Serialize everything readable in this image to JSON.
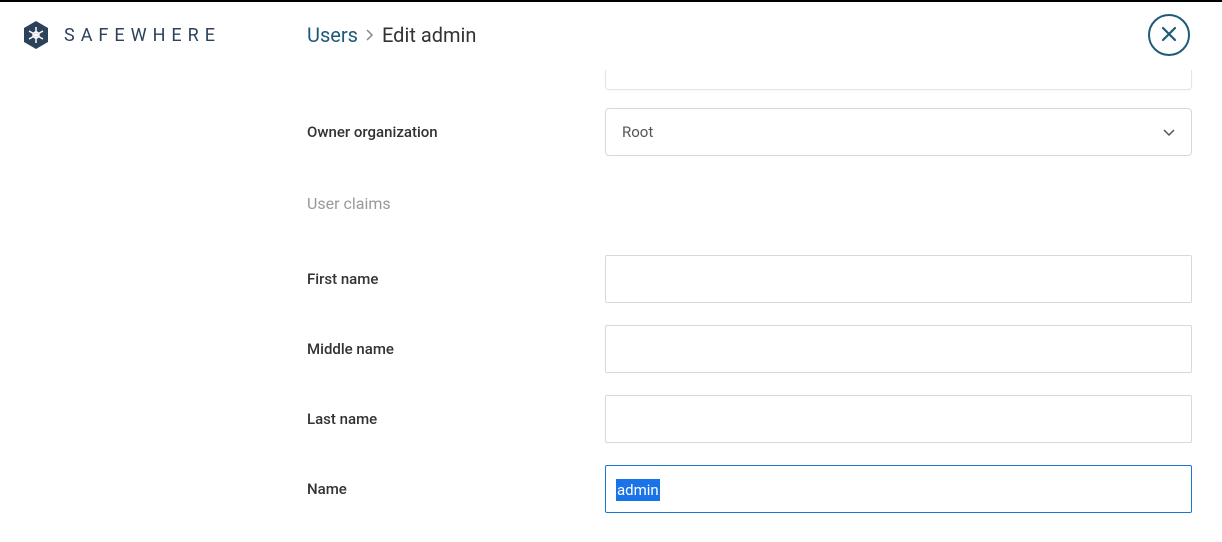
{
  "brand": "SAFEWHERE",
  "breadcrumbs": {
    "root": "Users",
    "current": "Edit admin"
  },
  "form": {
    "owner_org_label": "Owner organization",
    "owner_org_value": "Root",
    "section_heading": "User claims",
    "first_name_label": "First name",
    "first_name_value": "",
    "middle_name_label": "Middle name",
    "middle_name_value": "",
    "last_name_label": "Last name",
    "last_name_value": "",
    "name_label": "Name",
    "name_value": "admin"
  }
}
